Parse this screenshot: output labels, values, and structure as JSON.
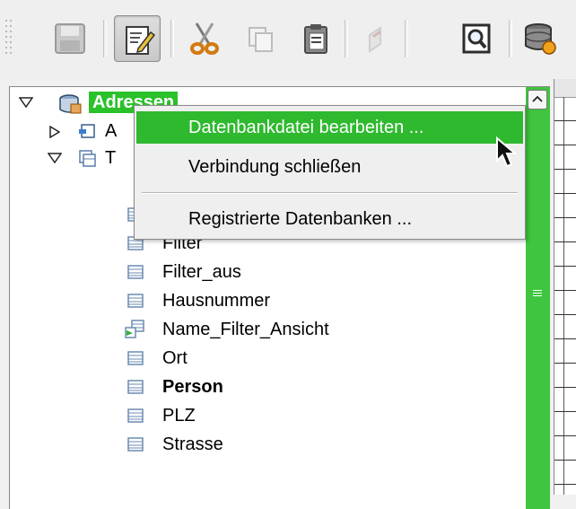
{
  "toolbar": {
    "buttons": [
      {
        "name": "save-button",
        "icon": "floppy-disk-icon",
        "enabled": false
      },
      {
        "name": "edit-mode-button",
        "icon": "edit-document-icon",
        "enabled": true,
        "active": true
      },
      {
        "name": "cut-button",
        "icon": "scissors-icon",
        "enabled": true
      },
      {
        "name": "copy-button",
        "icon": "copy-icon",
        "enabled": false
      },
      {
        "name": "paste-button",
        "icon": "clipboard-icon",
        "enabled": true
      },
      {
        "name": "undo-button",
        "icon": "undo-icon",
        "enabled": false
      },
      {
        "name": "preview-button",
        "icon": "magnifier-document-icon",
        "enabled": true
      },
      {
        "name": "database-button",
        "icon": "database-icon",
        "enabled": true
      }
    ]
  },
  "tree": {
    "root": {
      "label": "Adressen",
      "icon": "database-icon",
      "expanded": true,
      "selected": true
    },
    "partial_rows": [
      {
        "label": "A",
        "icon": "queries-folder-icon",
        "expanded": false
      },
      {
        "label": "T",
        "icon": "tables-folder-icon",
        "expanded": true
      }
    ],
    "items": [
      {
        "label": "",
        "icon": "table-icon"
      },
      {
        "label": "Filter",
        "icon": "table-icon"
      },
      {
        "label": "Filter_aus",
        "icon": "table-icon"
      },
      {
        "label": "Hausnummer",
        "icon": "table-icon"
      },
      {
        "label": "Name_Filter_Ansicht",
        "icon": "view-icon"
      },
      {
        "label": "Ort",
        "icon": "table-icon"
      },
      {
        "label": "Person",
        "icon": "table-icon",
        "bold": true
      },
      {
        "label": "PLZ",
        "icon": "table-icon"
      },
      {
        "label": "Strasse",
        "icon": "table-icon"
      }
    ]
  },
  "context_menu": {
    "items": [
      {
        "label": "Datenbankdatei bearbeiten ...",
        "highlighted": true
      },
      {
        "label": "Verbindung schließen",
        "highlighted": false
      },
      {
        "label": "Registrierte Datenbanken ...",
        "highlighted": false
      }
    ]
  },
  "colors": {
    "selection": "#2bc12b",
    "scrollbar": "#3fc53f",
    "toolbar_bg": "#efefef"
  }
}
